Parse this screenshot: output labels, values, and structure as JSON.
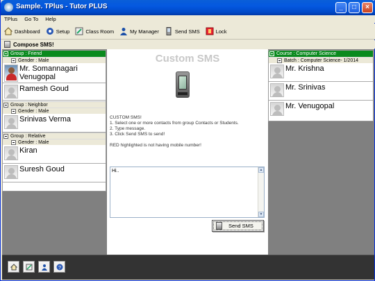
{
  "window": {
    "title": "Sample. TPlus - Tutor PLUS",
    "min": "_",
    "max": "□",
    "close": "×"
  },
  "menu": [
    "TPlus",
    "Go To",
    "Help"
  ],
  "toolbar": [
    {
      "label": "Dashboard",
      "icon": "home-icon"
    },
    {
      "label": "Setup",
      "icon": "setup-icon"
    },
    {
      "label": "Class Room",
      "icon": "classroom-icon"
    },
    {
      "label": "My Manager",
      "icon": "user-icon"
    },
    {
      "label": "Send SMS",
      "icon": "phone-icon"
    },
    {
      "label": "Lock",
      "icon": "lock-icon"
    }
  ],
  "header": {
    "title": "Compose SMS!"
  },
  "left": {
    "groups": [
      {
        "group": "Group : Friend",
        "gender": "Gender : Male",
        "people": [
          "Mr. Somannagari Venugopal",
          "Ramesh Goud"
        ]
      },
      {
        "group": "Group : Neighbor",
        "gender": "Gender : Male",
        "people": [
          "Srinivas Verma"
        ]
      },
      {
        "group": "Group : Relative",
        "gender": "Gender : Male",
        "people": [
          "Kiran",
          "Suresh Goud"
        ]
      }
    ]
  },
  "center": {
    "title": "Custom SMS",
    "instructions": [
      "CUSTOM SMS!",
      "1. Select one or more contacts from group Contacts or Students.",
      "2. Type message.",
      "3. Click Send SMS to send!",
      "",
      "RED highlighted is not having mobile number!"
    ],
    "message": "Hi..",
    "send_label": "Send SMS"
  },
  "right": {
    "course": "Course : Computer Science",
    "batch": "Batch : Computer Science- 1/2014",
    "people": [
      "Mr. Krishna",
      "Mr. Srinivas",
      "Mr. Venugopal"
    ]
  },
  "colors": {
    "group_header": "#0a8a1e",
    "background": "#808080"
  }
}
